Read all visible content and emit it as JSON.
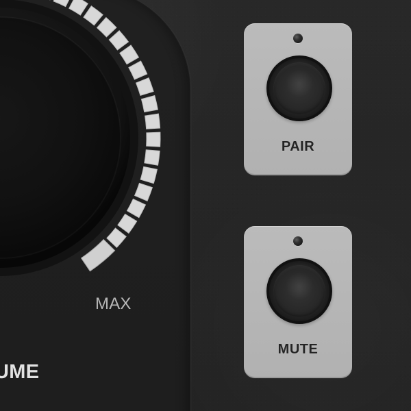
{
  "panel": {
    "volume_label": "UME",
    "max_label": "MAX",
    "volume_level_fraction": 1.0,
    "colors": {
      "background": "#242424",
      "panel": "#202020",
      "meter_active": "#d8d8d8",
      "button_card": "#b7b7b7",
      "text_light": "#e2e2e2",
      "text_muted": "#b7b7b7",
      "text_dark": "#242424"
    }
  },
  "buttons": [
    {
      "label": "PAIR",
      "led_icon": "status-led"
    },
    {
      "label": "MUTE",
      "led_icon": "status-led"
    }
  ]
}
